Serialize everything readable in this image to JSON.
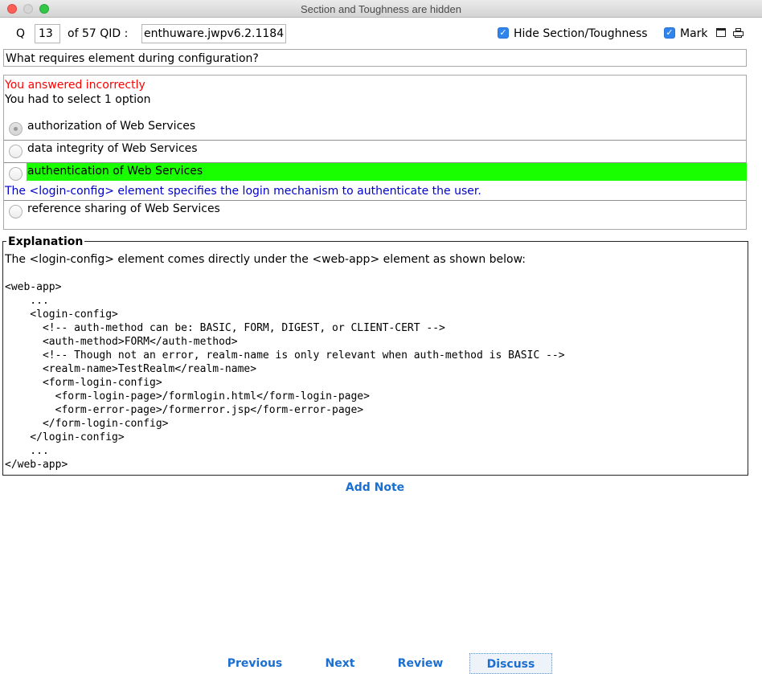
{
  "window": {
    "title": "Section and Toughness are hidden"
  },
  "toolbar": {
    "q_label": "Q",
    "question_number": "13",
    "of_label": "of 57 QID :",
    "qid_value": "enthuware.jwpv6.2.1184",
    "hide_section_label": "Hide Section/Toughness",
    "hide_section_checked": true,
    "mark_label": "Mark",
    "mark_checked": true,
    "window_icon": "window-icon",
    "print_icon": "print-icon"
  },
  "question": {
    "text": "What requires  element during configuration?"
  },
  "answer": {
    "result": "You answered incorrectly",
    "instruction": "You had to select 1 option",
    "result_color": "#ff0000",
    "correct_color": "#1aff00",
    "explanation_color": "#0000cc",
    "options": [
      {
        "label": "authorization of Web Services",
        "selected": true,
        "correct": false
      },
      {
        "label": "data integrity of Web Services",
        "selected": false,
        "correct": false
      },
      {
        "label": "authentication of Web Services",
        "selected": false,
        "correct": true
      },
      {
        "label": "reference sharing of Web Services",
        "selected": false,
        "correct": false
      }
    ],
    "correct_explanation": "The <login-config> element specifies the login mechanism to authenticate the user."
  },
  "explanation": {
    "legend": "Explanation",
    "intro": "The <login-config> element comes directly under the <web-app> element as shown below:",
    "code": "<web-app>\n    ...\n    <login-config>\n      <!-- auth-method can be: BASIC, FORM, DIGEST, or CLIENT-CERT -->\n      <auth-method>FORM</auth-method>\n      <!-- Though not an error, realm-name is only relevant when auth-method is BASIC -->\n      <realm-name>TestRealm</realm-name>\n      <form-login-config>\n        <form-login-page>/formlogin.html</form-login-page>\n        <form-error-page>/formerror.jsp</form-error-page>\n      </form-login-config>\n    </login-config>\n    ...\n</web-app>"
  },
  "actions": {
    "add_note": "Add Note",
    "previous": "Previous",
    "next": "Next",
    "review": "Review",
    "discuss": "Discuss",
    "link_color": "#1a6fd0"
  }
}
